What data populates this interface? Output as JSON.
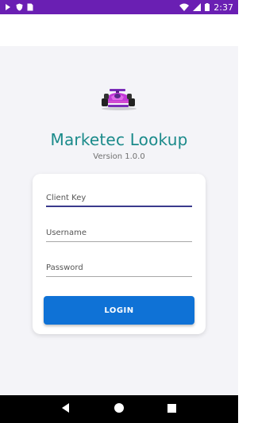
{
  "status_bar": {
    "time": "2:37",
    "icons": [
      "notification-icon",
      "shield-icon",
      "sim-card-icon",
      "wifi-icon",
      "cellular-signal-icon",
      "battery-icon"
    ]
  },
  "app": {
    "title": "Marketec Lookup",
    "version": "Version 1.0.0",
    "logo": "race-car-logo",
    "accent_color": "#1a8a8a",
    "primary_color": "#0f72d6"
  },
  "form": {
    "client_key_placeholder": "Client Key",
    "username_placeholder": "Username",
    "password_placeholder": "Password",
    "login_label": "LOGIN"
  },
  "nav_bar": {
    "buttons": [
      "back-icon",
      "home-icon",
      "recents-icon"
    ]
  }
}
